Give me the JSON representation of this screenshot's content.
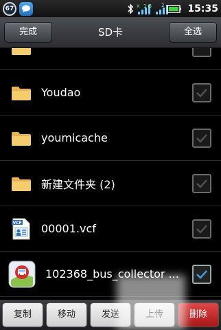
{
  "status_bar": {
    "badge_count": "67",
    "time": "15:35",
    "signal_label_1": "1",
    "signal_label_2": "2",
    "net_label": "G"
  },
  "title_bar": {
    "done_label": "完成",
    "title": "SD卡",
    "select_all_label": "全选"
  },
  "files": [
    {
      "name": "Youdao",
      "type": "folder",
      "checked": false
    },
    {
      "name": "youmicache",
      "type": "folder",
      "checked": false
    },
    {
      "name": "新建文件夹 (2)",
      "type": "folder",
      "checked": false
    },
    {
      "name": "00001.vcf",
      "type": "vcf",
      "checked": false
    },
    {
      "name": "102368_bus_collector ...",
      "type": "app",
      "checked": true
    }
  ],
  "partial_row": {
    "type": "folder",
    "checked": false
  },
  "toolbar": {
    "copy_label": "复制",
    "move_label": "移动",
    "send_label": "发送",
    "upload_label": "上传",
    "delete_label": "删除"
  },
  "colors": {
    "delete": "#c62828",
    "folder": "#f3c05a",
    "check": "#3f9be0"
  }
}
